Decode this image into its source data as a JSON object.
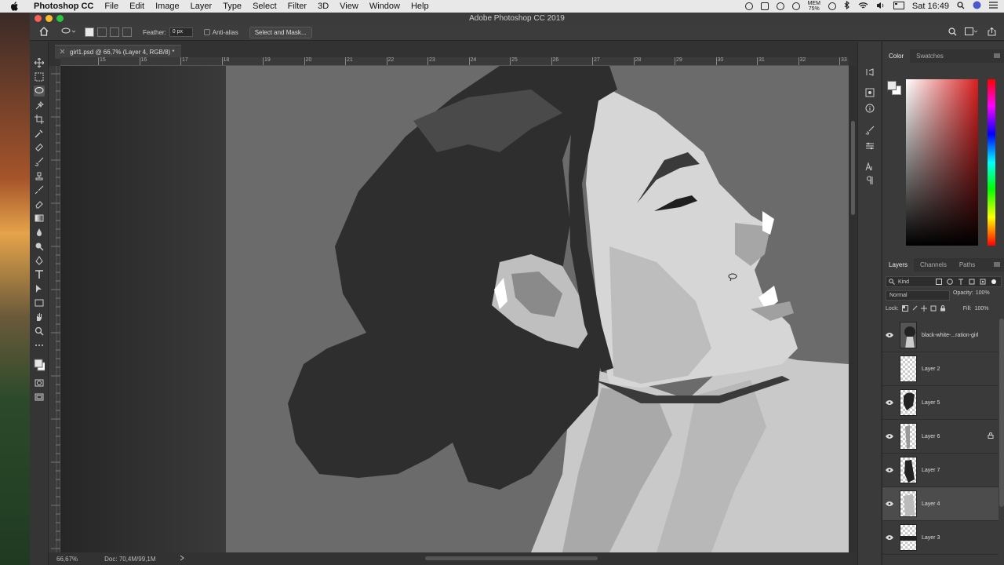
{
  "menubar": {
    "app_name": "Photoshop CC",
    "items": [
      "File",
      "Edit",
      "Image",
      "Layer",
      "Type",
      "Select",
      "Filter",
      "3D",
      "View",
      "Window",
      "Help"
    ],
    "mem_label": "MEM",
    "mem_value": "75%",
    "clock": "Sat 16:49"
  },
  "window": {
    "title": "Adobe Photoshop CC 2019"
  },
  "options": {
    "feather_label": "Feather:",
    "feather_value": "0 px",
    "antialias_label": "Anti-alias",
    "select_mask_label": "Select and Mask..."
  },
  "document": {
    "tab_title": "girl1.psd @ 66,7% (Layer 4, RGB/8) *",
    "ruler_ticks": [
      "15",
      "16",
      "17",
      "18",
      "19",
      "20",
      "21",
      "22",
      "23",
      "24",
      "25",
      "26",
      "27",
      "28",
      "29",
      "30",
      "31",
      "32",
      "33"
    ]
  },
  "status": {
    "zoom": "66,67%",
    "doc_size": "Doc: 70,4M/99,1M"
  },
  "color_panel": {
    "tabs": [
      "Color",
      "Swatches"
    ]
  },
  "layers_panel": {
    "tabs": [
      "Layers",
      "Channels",
      "Paths"
    ],
    "filter_label": "Kind",
    "blend_mode": "Normal",
    "opacity_label": "Opacity:",
    "opacity_value": "100%",
    "lock_label": "Lock:",
    "fill_label": "Fill:",
    "fill_value": "100%",
    "layers": [
      {
        "name": "black-white-...ration-girl",
        "visible": true,
        "selected": false,
        "locked": false
      },
      {
        "name": "Layer 2",
        "visible": false,
        "selected": false,
        "locked": false
      },
      {
        "name": "Layer 5",
        "visible": true,
        "selected": false,
        "locked": false
      },
      {
        "name": "Layer 6",
        "visible": true,
        "selected": false,
        "locked": true
      },
      {
        "name": "Layer 7",
        "visible": true,
        "selected": false,
        "locked": false
      },
      {
        "name": "Layer 4",
        "visible": true,
        "selected": true,
        "locked": false
      },
      {
        "name": "Layer 3",
        "visible": true,
        "selected": false,
        "locked": false
      }
    ]
  },
  "colors": {
    "panel_bg": "#3a3a3a",
    "canvas_gray": "#6b6b6b",
    "hair": "#2e2e2e"
  }
}
